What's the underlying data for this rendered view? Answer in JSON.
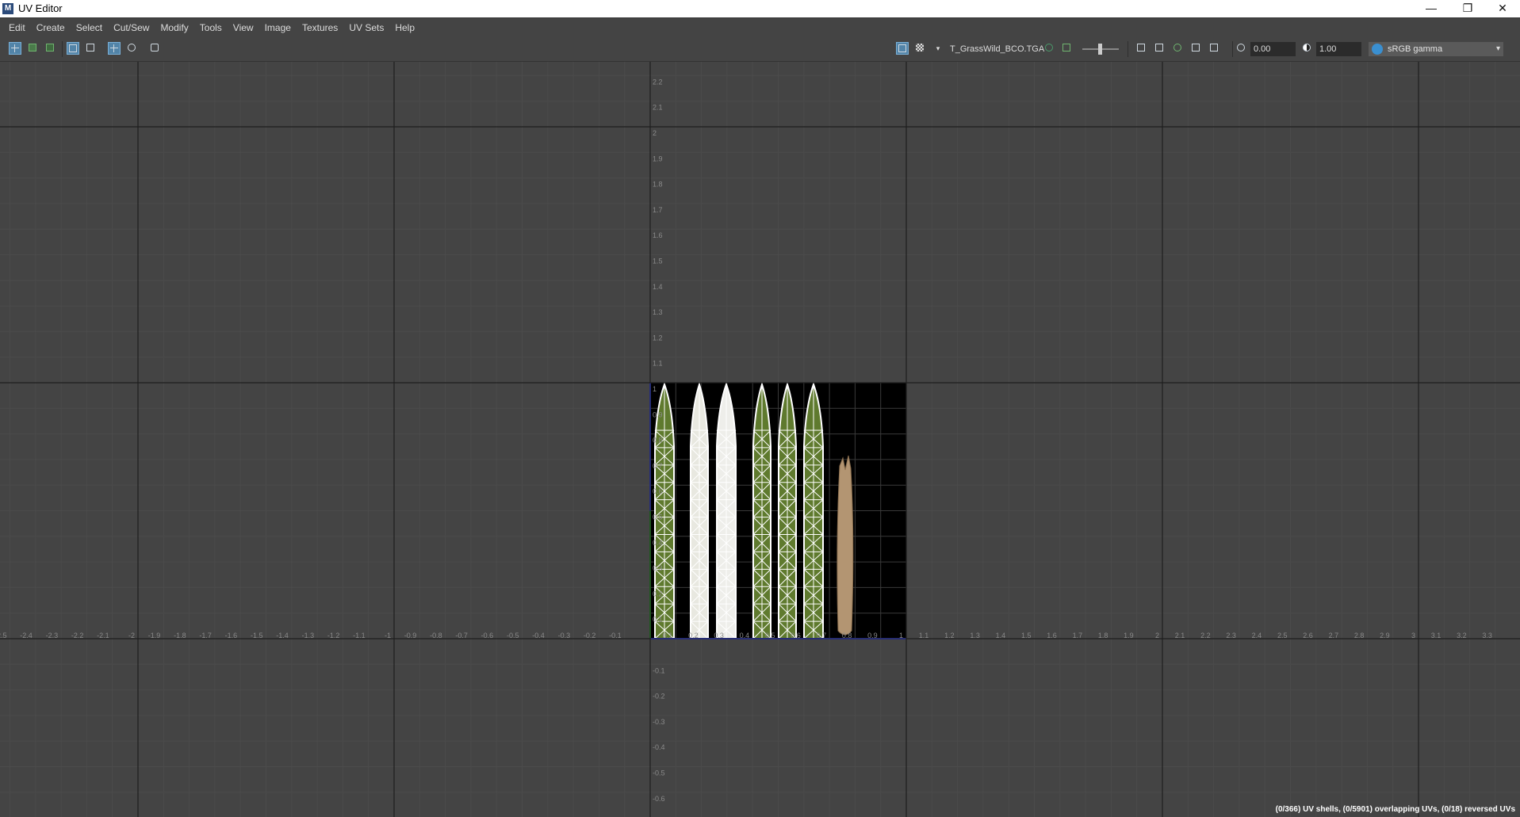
{
  "window": {
    "title": "UV Editor",
    "icon_label": "M",
    "minimize_glyph": "—",
    "restore_glyph": "❐",
    "close_glyph": "✕"
  },
  "menu": [
    "Edit",
    "Create",
    "Select",
    "Cut/Sew",
    "Modify",
    "Tools",
    "View",
    "Image",
    "Textures",
    "UV Sets",
    "Help"
  ],
  "toolbar": {
    "texture_name": "T_GrassWild_BCO.TGA",
    "exposure_value": "0.00",
    "gamma_value": "1.00",
    "color_space": "sRGB gamma",
    "dropdown_glyph": "▾"
  },
  "viewport": {
    "x_axis_labels": [
      "-2.5",
      "-2.4",
      "-2.3",
      "-2.2",
      "-2.1",
      "-2",
      "-1.9",
      "-1.8",
      "-1.7",
      "-1.6",
      "-1.5",
      "-1.4",
      "-1.3",
      "-1.2",
      "-1.1",
      "-1",
      "-0.9",
      "-0.8",
      "-0.7",
      "-0.6",
      "-0.5",
      "-0.4",
      "-0.3",
      "-0.2",
      "-0.1",
      "",
      "0.1",
      "0.2",
      "0.3",
      "0.4",
      "0.5",
      "0.6",
      "0.7",
      "0.8",
      "0.9",
      "1",
      "1.1",
      "1.2",
      "1.3",
      "1.4",
      "1.5",
      "1.6",
      "1.7",
      "1.8",
      "1.9",
      "2",
      "2.1",
      "2.2",
      "2.3",
      "2.4",
      "2.5",
      "2.6",
      "2.7",
      "2.8",
      "2.9",
      "3",
      "3.1",
      "3.2",
      "3.3"
    ],
    "y_axis_labels": [
      "2.2",
      "2.1",
      "2",
      "1.9",
      "1.8",
      "1.7",
      "1.6",
      "1.5",
      "1.4",
      "1.3",
      "1.2",
      "1.1",
      "1",
      "0.9",
      "0.8",
      "0.7",
      "0.6",
      "0.5",
      "0.4",
      "0.3",
      "0.2",
      "0.1",
      "",
      "-0.1",
      "-0.2",
      "-0.3",
      "-0.4",
      "-0.5",
      "-0.6",
      "-0.7"
    ]
  },
  "status_text": "(0/366) UV shells, (0/5901) overlapping UVs, (0/18) reversed UVs",
  "colors": {
    "viewport_bg": "#444444",
    "grid_minor": "#4b4b4b",
    "grid_major": "#1e1e1e",
    "label": "#8a8a8a",
    "grass": "#5f7a2e",
    "uv_wire": "#ffffff",
    "axis_u": "#3344ff",
    "axis_v": "#22aa22"
  }
}
